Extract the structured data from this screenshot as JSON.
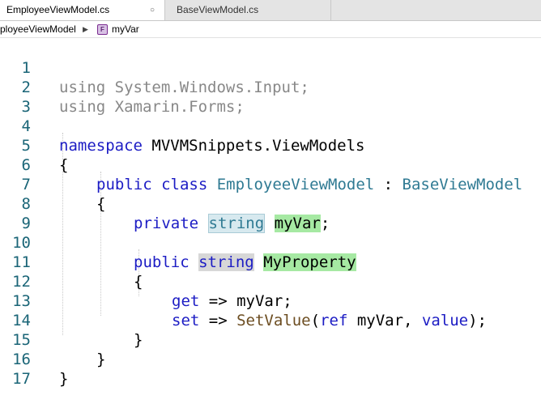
{
  "tabs": [
    {
      "label": "EmployeeViewModel.cs",
      "close_glyph": "○"
    },
    {
      "label": "BaseViewModel.cs"
    }
  ],
  "breadcrumb": {
    "file": "EmployeeViewModel",
    "separator": "▶",
    "member_icon_letter": "F",
    "member": "myVar"
  },
  "colors": {
    "keyword": "#1c1cc4",
    "type": "#2f7a93",
    "method": "#6c4d21",
    "line_number": "#1a6577",
    "unused_using": "#888888",
    "symbol_highlight": "#a6e9a3"
  },
  "code": {
    "line_numbers": [
      "1",
      "2",
      "3",
      "4",
      "5",
      "6",
      "7",
      "8",
      "9",
      "10",
      "11",
      "12",
      "13",
      "14",
      "15",
      "16",
      "17"
    ],
    "l1": {
      "kw": "using",
      "rest": " System.Windows.Input;"
    },
    "l2": {
      "kw": "using",
      "rest": " Xamarin.Forms;"
    },
    "l4": {
      "kw": "namespace",
      "rest": " MVVMSnippets.ViewModels"
    },
    "l5": {
      "text": "{"
    },
    "l6": {
      "kw": "public class",
      "type": "EmployeeViewModel",
      "sep": " : ",
      "base": "BaseViewModel"
    },
    "l7": {
      "text": "{"
    },
    "l8": {
      "kw": "private",
      "type": "string",
      "name": "myVar",
      "end": ";"
    },
    "l10": {
      "kw": "public",
      "type": "string",
      "name": "MyProperty"
    },
    "l11": {
      "text": "{"
    },
    "l12": {
      "kw": "get",
      "rest": " => myVar;"
    },
    "l13": {
      "kw": "set",
      "arrow": " => ",
      "method": "SetValue",
      "open": "(",
      "ref": "ref",
      "mid": " myVar, ",
      "value": "value",
      "close": ");"
    },
    "l14": {
      "text": "}"
    },
    "l15": {
      "text": "}"
    },
    "l16": {
      "text": "}"
    }
  }
}
